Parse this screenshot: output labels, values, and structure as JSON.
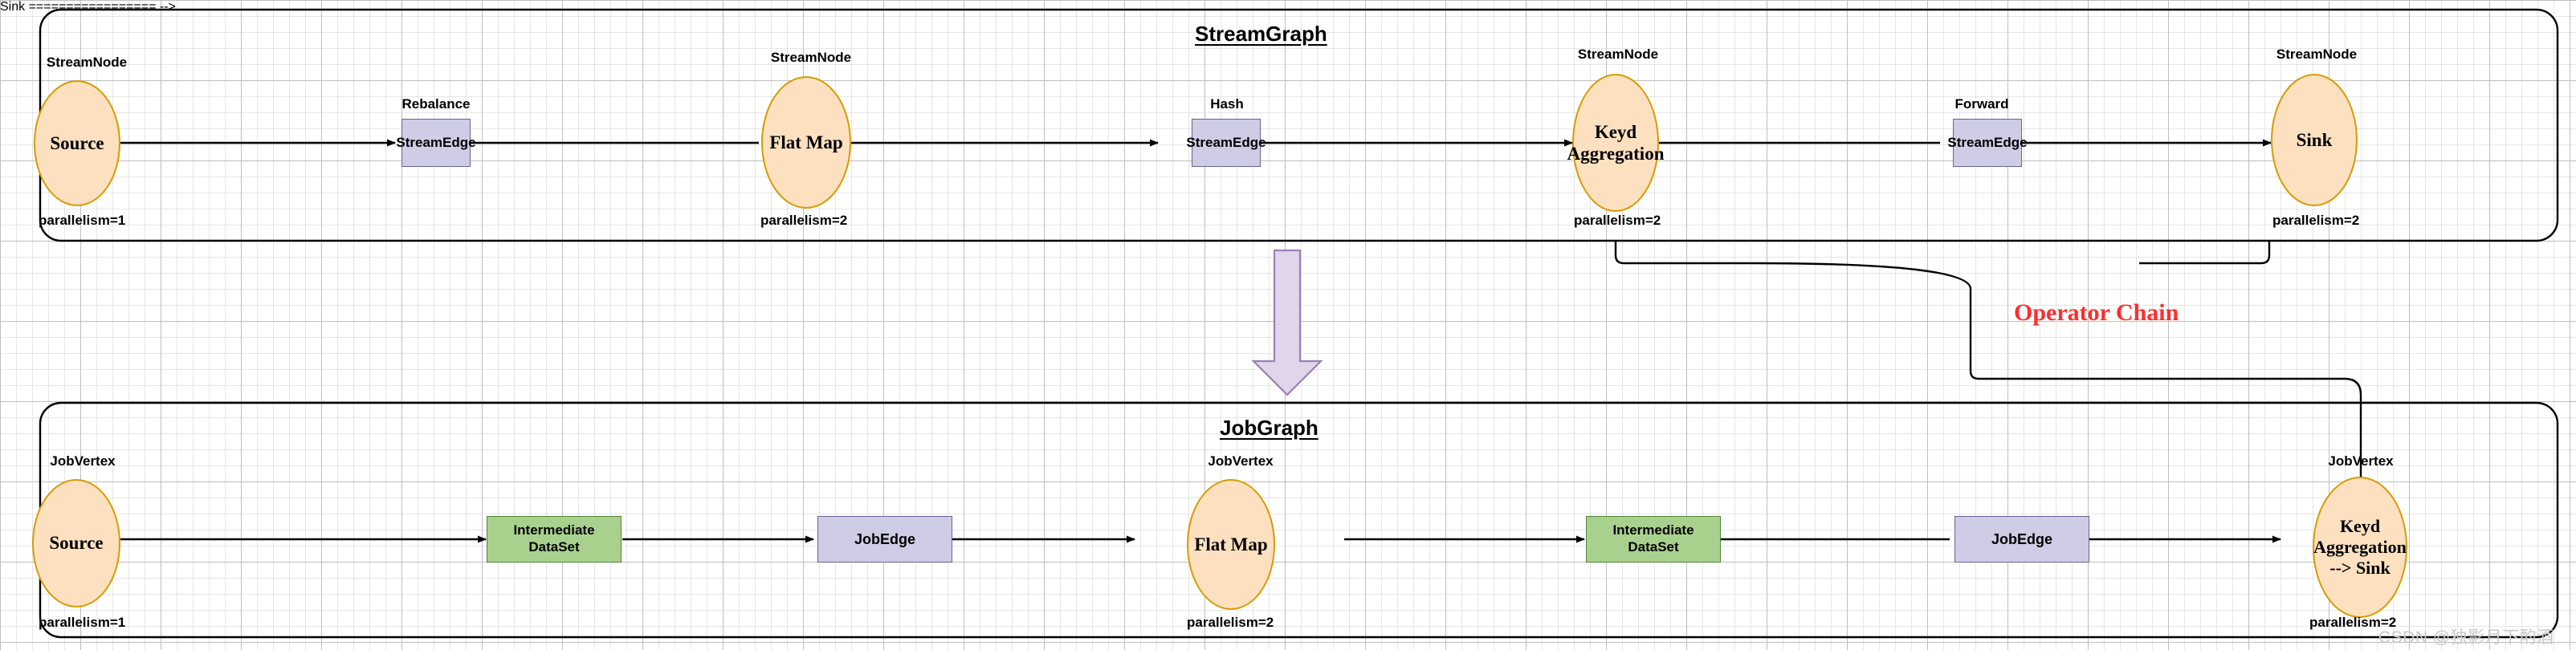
{
  "diagram": {
    "background": "grid-paper",
    "colors": {
      "node_fill": "#FCE0C0",
      "node_stroke": "#D79B00",
      "edge_box_fill": "#CFCCE5",
      "edge_box_stroke": "#6B6295",
      "dataset_fill": "#A9D18E",
      "dataset_stroke": "#548235",
      "arrow_fill": "#E0D5EA",
      "arrow_stroke": "#9B7FB5",
      "annotation": "#FF2D2D",
      "line": "#000000"
    }
  },
  "streamgraph": {
    "title": "StreamGraph",
    "nodes": [
      {
        "caption": "StreamNode",
        "label": "Source",
        "parallelism": "parallelism=1"
      },
      {
        "caption": "StreamNode",
        "label": "Flat Map",
        "parallelism": "parallelism=2"
      },
      {
        "caption": "StreamNode",
        "label": "Keyd\nAggregation",
        "parallelism": "parallelism=2"
      },
      {
        "caption": "StreamNode",
        "label": "Sink",
        "parallelism": "parallelism=2"
      }
    ],
    "edges": [
      {
        "caption": "Rebalance",
        "label": "StreamEdge"
      },
      {
        "caption": "Hash",
        "label": "StreamEdge"
      },
      {
        "caption": "Forward",
        "label": "StreamEdge"
      }
    ]
  },
  "transition": {
    "arrow_icon": "down-arrow-icon",
    "annotation": "Operator Chain"
  },
  "jobgraph": {
    "title": "JobGraph",
    "nodes": [
      {
        "caption": "JobVertex",
        "label": "Source",
        "parallelism": "parallelism=1"
      },
      {
        "caption": "JobVertex",
        "label": "Flat Map",
        "parallelism": "parallelism=2"
      },
      {
        "caption": "JobVertex",
        "label": "Keyd\nAggregation\n--> Sink",
        "parallelism": "parallelism=2"
      }
    ],
    "datasets": [
      {
        "label": "Intermediate\nDataSet"
      },
      {
        "label": "Intermediate\nDataSet"
      }
    ],
    "edges": [
      {
        "label": "JobEdge"
      },
      {
        "label": "JobEdge"
      }
    ]
  },
  "watermark": {
    "text": "CSDN @独影月下酌酒"
  }
}
